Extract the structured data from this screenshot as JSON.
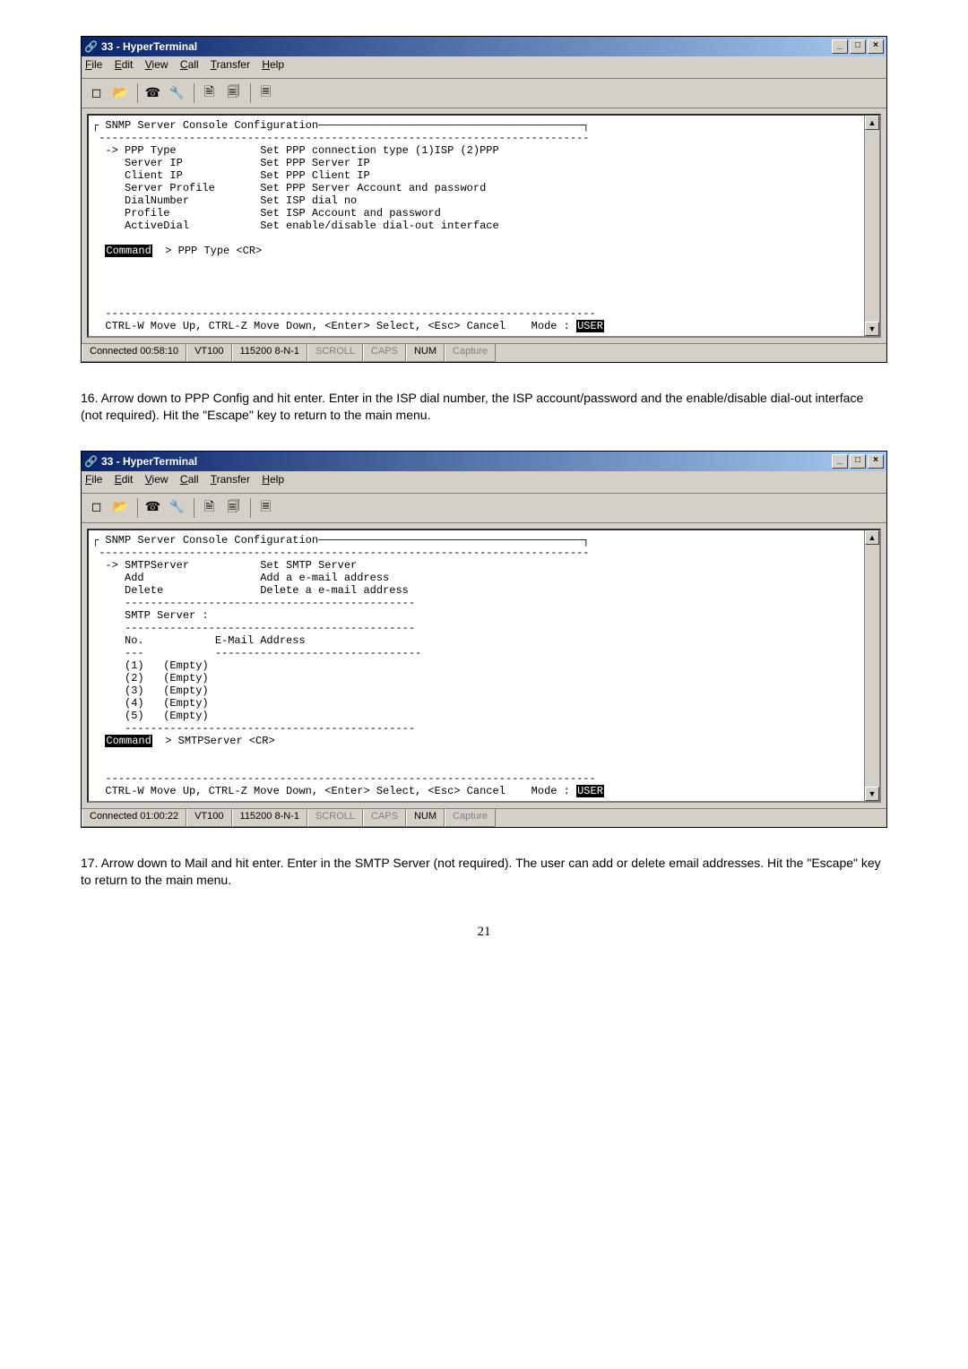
{
  "win1": {
    "title": "33 - HyperTerminal",
    "menus": {
      "file": "File",
      "edit": "Edit",
      "view": "View",
      "call": "Call",
      "transfer": "Transfer",
      "help": "Help"
    },
    "term": {
      "header": " SNMP Server Console Configuration",
      "sep1": " ----------------------------------------------------------------------------",
      "l1": "  -> PPP Type             Set PPP connection type (1)ISP (2)PPP",
      "l2": "     Server IP            Set PPP Server IP",
      "l3": "     Client IP            Set PPP Client IP",
      "l4": "     Server Profile       Set PPP Server Account and password",
      "l5": "     DialNumber           Set ISP dial no",
      "l6": "     Profile              Set ISP Account and password",
      "l7": "     ActiveDial           Set enable/disable dial-out interface",
      "cmd_label": "Command",
      "cmd_rest": "  > PPP Type <CR>",
      "footer_sep": "  ----------------------------------------------------------------------------",
      "footer": "  CTRL-W Move Up, CTRL-Z Move Down, <Enter> Select, <Esc> Cancel    Mode : ",
      "mode": "USER"
    },
    "status": {
      "connected": "Connected 00:58:10",
      "emul": "VT100",
      "baud": "115200 8-N-1",
      "scroll": "SCROLL",
      "caps": "CAPS",
      "num": "NUM",
      "capture": "Capture"
    }
  },
  "para16_num": "16.",
  "para16": "Arrow down to PPP Config and hit enter.  Enter in the ISP dial number, the ISP account/password and the enable/disable dial-out interface (not required).  Hit the \"Escape\" key to return to the main menu.",
  "win2": {
    "title": "33 - HyperTerminal",
    "menus": {
      "file": "File",
      "edit": "Edit",
      "view": "View",
      "call": "Call",
      "transfer": "Transfer",
      "help": "Help"
    },
    "term": {
      "header": " SNMP Server Console Configuration",
      "sep1": " ----------------------------------------------------------------------------",
      "l1": "  -> SMTPServer           Set SMTP Server",
      "l2": "     Add                  Add a e-mail address",
      "l3": "     Delete               Delete a e-mail address",
      "sep2": "     ---------------------------------------------",
      "l4": "     SMTP Server :",
      "sep3": "     ---------------------------------------------",
      "l5": "     No.           E-Mail Address",
      "sep4": "     ---           --------------------------------",
      "e1": "     (1)   (Empty)",
      "e2": "     (2)   (Empty)",
      "e3": "     (3)   (Empty)",
      "e4": "     (4)   (Empty)",
      "e5": "     (5)   (Empty)",
      "sep5": "     ---------------------------------------------",
      "cmd_label": "Command",
      "cmd_rest": "  > SMTPServer <CR>",
      "footer_sep": "  ----------------------------------------------------------------------------",
      "footer": "  CTRL-W Move Up, CTRL-Z Move Down, <Enter> Select, <Esc> Cancel    Mode : ",
      "mode": "USER"
    },
    "status": {
      "connected": "Connected 01:00:22",
      "emul": "VT100",
      "baud": "115200 8-N-1",
      "scroll": "SCROLL",
      "caps": "CAPS",
      "num": "NUM",
      "capture": "Capture"
    }
  },
  "para17_num": "17.",
  "para17": "Arrow down to Mail and hit enter.  Enter in the SMTP Server (not required).  The user can add or delete email addresses.  Hit the \"Escape\" key to return to the main menu.",
  "pagenum": "21",
  "icons": {
    "new": "◻",
    "open": "📂",
    "call": "☎",
    "props": "🔧",
    "send": "🗎",
    "recv": "🗐",
    "cfg": "🗏"
  }
}
